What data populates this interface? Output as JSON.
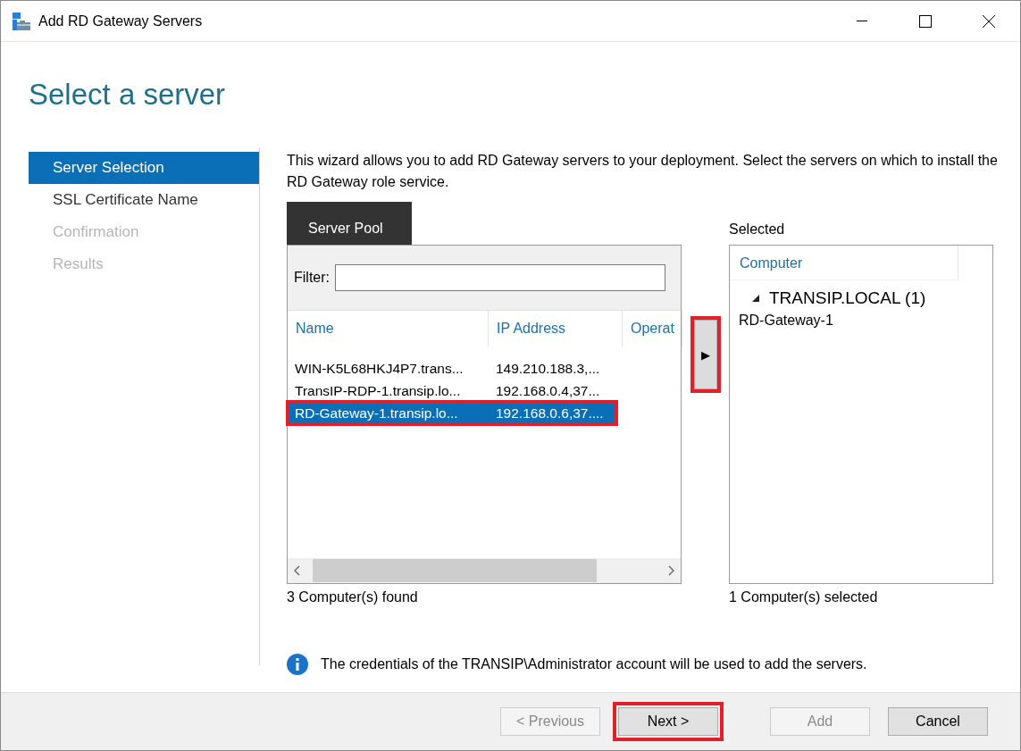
{
  "window": {
    "title": "Add RD Gateway Servers"
  },
  "page_title": "Select a server",
  "steps": [
    {
      "label": "Server Selection",
      "selected": true,
      "disabled": false
    },
    {
      "label": "SSL Certificate Name",
      "selected": false,
      "disabled": false
    },
    {
      "label": "Confirmation",
      "selected": false,
      "disabled": true
    },
    {
      "label": "Results",
      "selected": false,
      "disabled": true
    }
  ],
  "description": "This wizard allows you to add RD Gateway servers to your deployment. Select the servers on which to install the RD Gateway role service.",
  "server_pool": {
    "tab": "Server Pool",
    "filter_label": "Filter:",
    "columns": [
      "Name",
      "IP Address",
      "Operat"
    ],
    "rows": [
      {
        "cells": [
          "WIN-K5L68HKJ4P7.trans...",
          "149.210.188.3,..."
        ],
        "selected": false,
        "highlighted": false
      },
      {
        "cells": [
          "TransIP-RDP-1.transip.lo...",
          "192.168.0.4,37..."
        ],
        "selected": false,
        "highlighted": false
      },
      {
        "cells": [
          "RD-Gateway-1.transip.lo...",
          "192.168.0.6,37...."
        ],
        "selected": true,
        "highlighted": true
      }
    ],
    "status": "3 Computer(s) found"
  },
  "add_button": {
    "label": "▶",
    "highlighted": true
  },
  "selected_panel": {
    "title": "Selected",
    "column": "Computer",
    "groups": [
      {
        "label": "TRANSIP.LOCAL (1)",
        "expanded": true,
        "children": [
          {
            "label": "RD-Gateway-1"
          }
        ]
      }
    ],
    "status": "1 Computer(s) selected"
  },
  "info": "The credentials of the TRANSIP\\Administrator account will be used to add the servers.",
  "buttons": [
    {
      "label": "< Previous",
      "disabled": true,
      "highlighted": false
    },
    {
      "label": "Next >",
      "disabled": false,
      "highlighted": true
    },
    {
      "label": "Add",
      "disabled": true,
      "highlighted": false
    },
    {
      "label": "Cancel",
      "disabled": false,
      "highlighted": false
    }
  ]
}
